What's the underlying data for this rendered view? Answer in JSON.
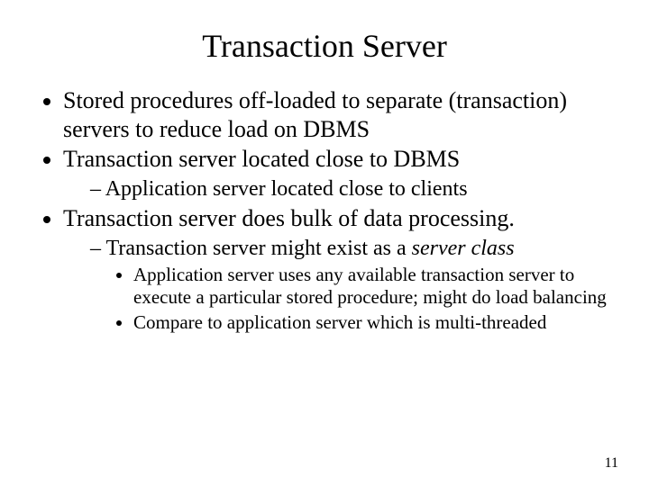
{
  "title": "Transaction Server",
  "bullets": {
    "b1": "Stored procedures off-loaded to separate (transaction) servers to reduce load on DBMS",
    "b2": "Transaction server located close to DBMS",
    "b2_1": "Application server located close to clients",
    "b3": "Transaction server does bulk of data processing.",
    "b3_1_a": "Transaction server might exist as a ",
    "b3_1_b": "server class",
    "b3_1_1": "Application server uses any available transaction server to execute a particular stored procedure; might do load balancing",
    "b3_1_2": "Compare to application server which is multi-threaded"
  },
  "page_number": "11"
}
